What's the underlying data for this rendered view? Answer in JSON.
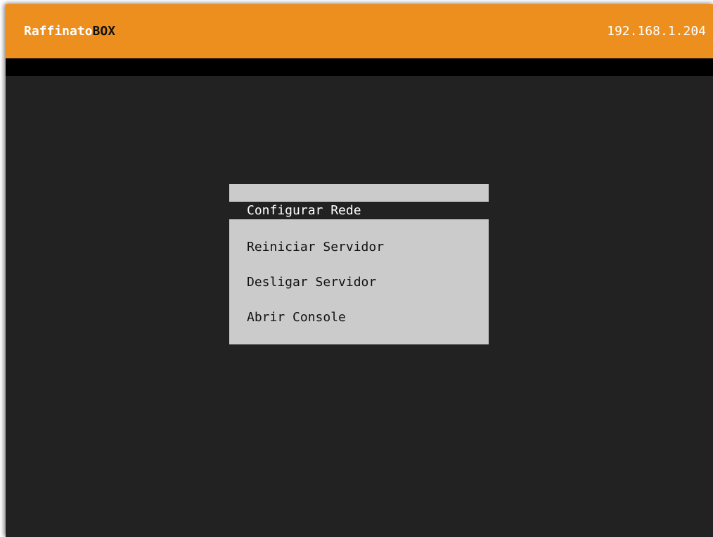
{
  "header": {
    "brand_prefix": "Raffinato",
    "brand_suffix": "BOX",
    "ip_address": "192.168.1.204"
  },
  "colors": {
    "header_bg": "#ec8f1e",
    "screen_bg": "#222222",
    "menu_bg": "#cbcbcb",
    "selected_bg": "#222222",
    "selected_text": "#ffffff"
  },
  "menu": {
    "selected_item": "Configurar Rede",
    "items": [
      {
        "label": "Reiniciar Servidor"
      },
      {
        "label": "Desligar Servidor"
      },
      {
        "label": "Abrir Console"
      }
    ]
  }
}
